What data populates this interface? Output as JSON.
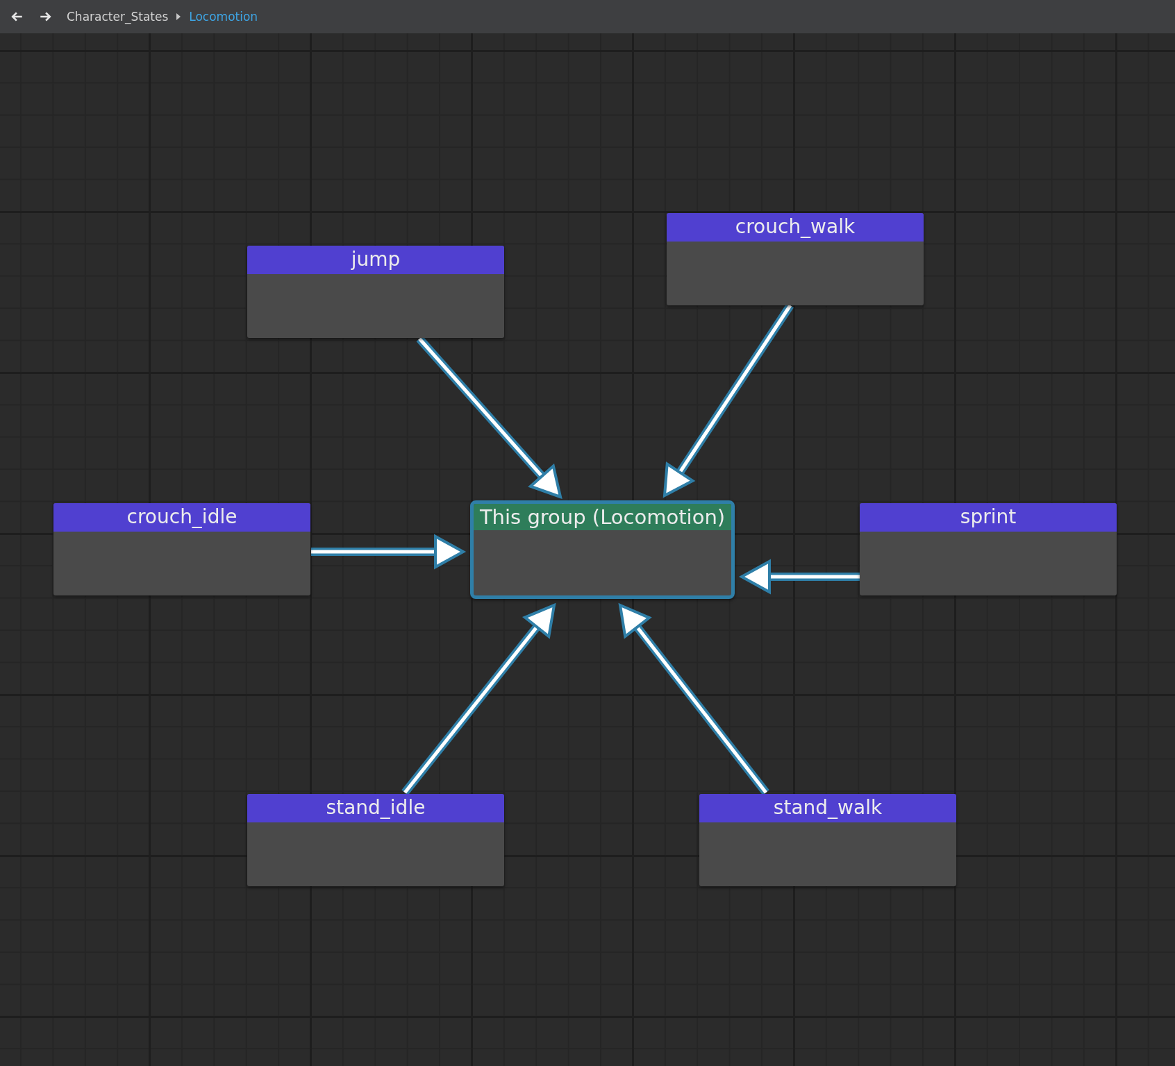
{
  "breadcrumb": [
    {
      "label": "Character_States",
      "selected": false
    },
    {
      "label": "Locomotion",
      "selected": true
    }
  ],
  "nodes": [
    {
      "label": "jump",
      "kind": "state"
    },
    {
      "label": "crouch_walk",
      "kind": "state"
    },
    {
      "label": "crouch_idle",
      "kind": "state"
    },
    {
      "label": "This group (Locomotion)",
      "kind": "group"
    },
    {
      "label": "sprint",
      "kind": "state"
    },
    {
      "label": "stand_idle",
      "kind": "state"
    },
    {
      "label": "stand_walk",
      "kind": "state"
    }
  ]
}
